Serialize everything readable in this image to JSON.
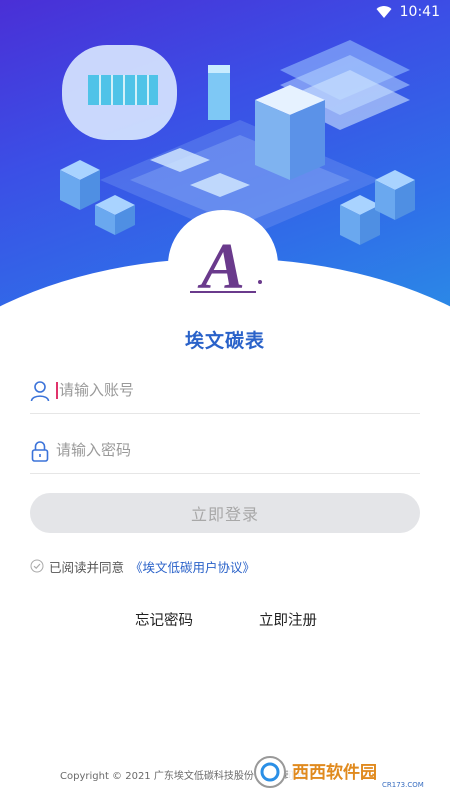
{
  "status_bar": {
    "time": "10:41",
    "wifi_icon": "wifi-icon"
  },
  "brand": {
    "title": "埃文碳表",
    "logo_letter": "A"
  },
  "form": {
    "account_placeholder": "请输入账号",
    "password_placeholder": "请输入密码",
    "login_label": "立即登录"
  },
  "agreement": {
    "text": "已阅读并同意",
    "link": "《埃文低碳用户协议》"
  },
  "links": {
    "forgot": "忘记密码",
    "register": "立即注册"
  },
  "footer": {
    "copyright": "Copyright © 2021 广东埃文低碳科技股份有限公司 版"
  },
  "watermark": {
    "brand": "西西软件园",
    "site": "CR173.COM"
  },
  "colors": {
    "accent": "#2a62c9",
    "logo_purple": "#6a3a8c",
    "button_bg": "#e4e5e8"
  }
}
